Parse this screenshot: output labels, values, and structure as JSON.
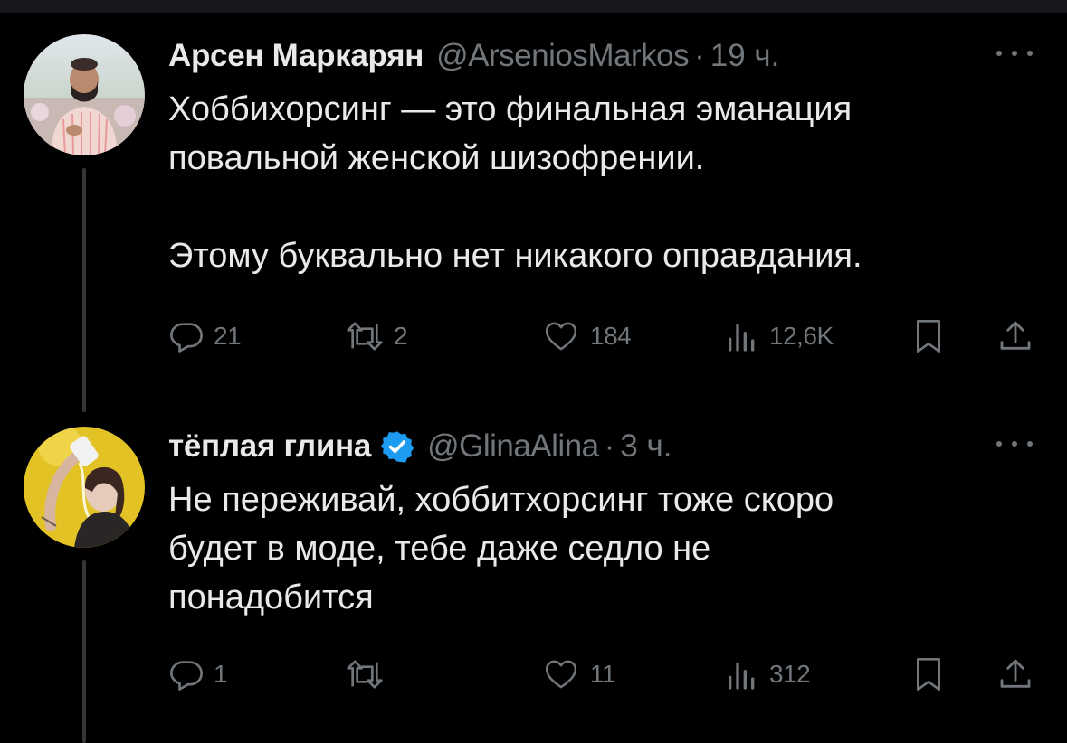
{
  "tweets": [
    {
      "display_name": "Арсен Маркарян",
      "verified": false,
      "handle": "@ArseniosMarkos",
      "separator": "·",
      "time": "19 ч.",
      "text": "Хоббихорсинг — это финальная эманация\nповальной женской шизофрении.\n\nЭтому буквально нет никакого оправдания.",
      "replies": "21",
      "retweets": "2",
      "likes": "184",
      "views": "12,6K"
    },
    {
      "display_name": "тёплая глина",
      "verified": true,
      "handle": "@GlinaAlina",
      "separator": "·",
      "time": "3 ч.",
      "text": "Не переживай, хоббитхорсинг тоже скоро\nбудет в моде, тебе даже седло не\nпонадобится",
      "replies": "1",
      "retweets": "",
      "likes": "11",
      "views": "312"
    }
  ],
  "colors": {
    "background": "#000000",
    "text": "#e7e9ea",
    "muted": "#71767b",
    "thread_line": "#333639",
    "verified": "#1d9bf0"
  }
}
